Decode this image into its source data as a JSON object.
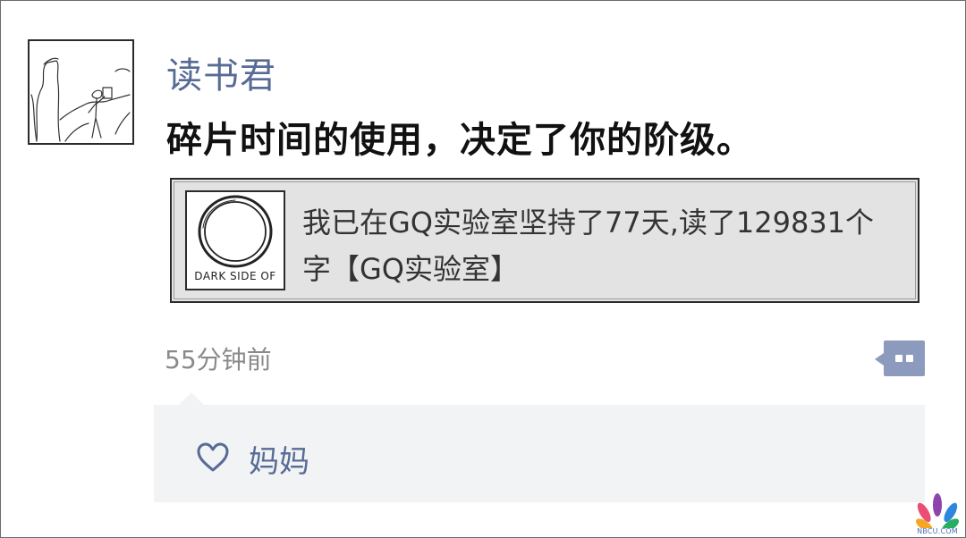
{
  "post": {
    "author": "读书君",
    "text": "碎片时间的使用，决定了你的阶级。",
    "time": "55分钟前"
  },
  "share_card": {
    "thumb_caption": "DARK SIDE OF",
    "text": "我已在GQ实验室坚持了77天,读了129831个字【GQ实验室】"
  },
  "likes": {
    "icon": "heart-outline-icon",
    "names": "妈妈"
  },
  "comment_button": {
    "icon": "ellipsis-icon"
  },
  "watermark": {
    "text": "NBCU.COM"
  },
  "colors": {
    "link": "#576b95",
    "meta": "#8a8a8a",
    "comment_button": "#8c9bbd",
    "like_panel_bg": "#f2f3f5",
    "card_bg": "#e3e3e3"
  }
}
